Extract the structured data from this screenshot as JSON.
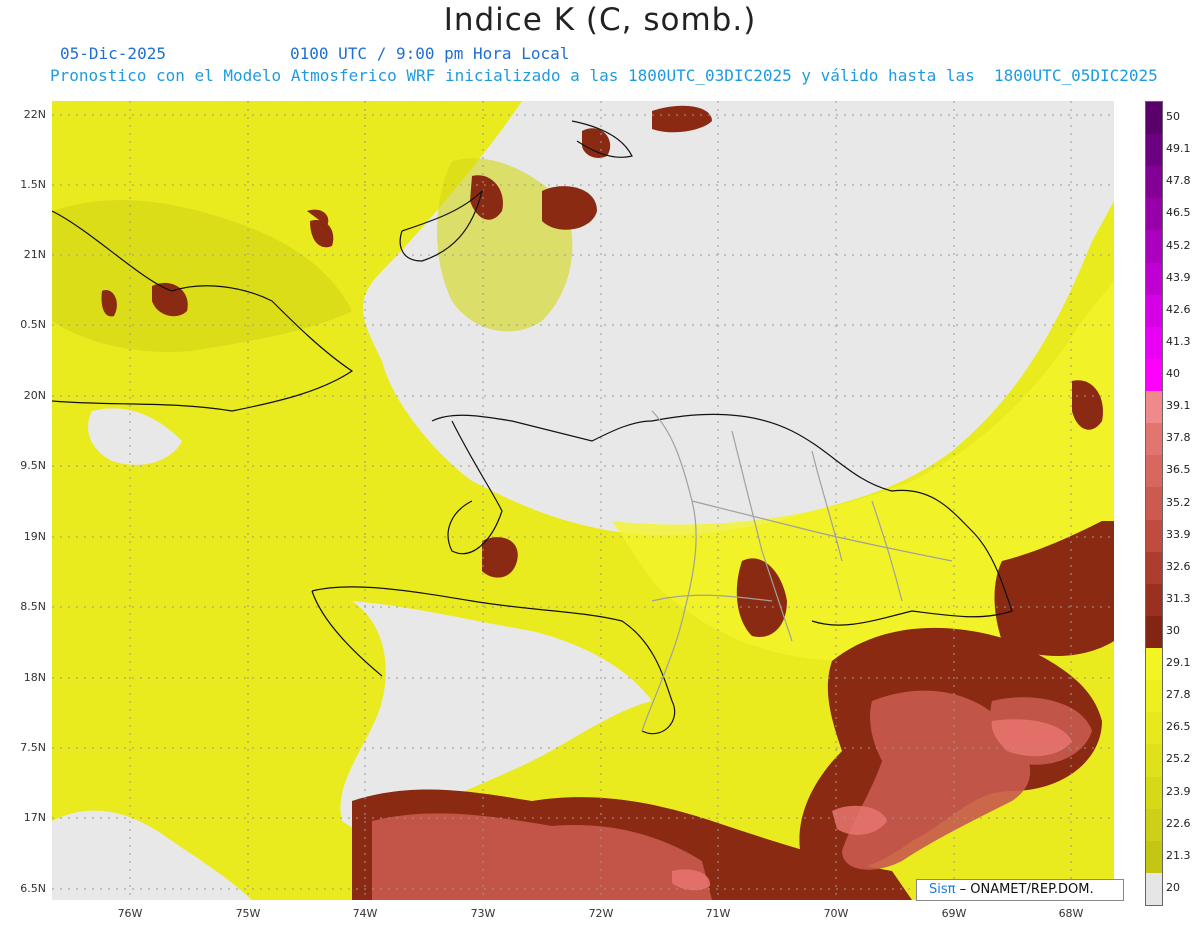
{
  "header": {
    "title": "Indice K (C, somb.)",
    "date": "05-Dic-2025",
    "time": "0100 UTC / 9:00 pm Hora Local",
    "model": "Pronostico con el Modelo Atmosferico WRF inicializado a las 1800UTC_03DIC2025 y válido hasta las  1800UTC_05DIC2025"
  },
  "map": {
    "lat_labels": [
      "22N",
      "1.5N",
      "21N",
      "0.5N",
      "20N",
      "9.5N",
      "19N",
      "8.5N",
      "18N",
      "7.5N",
      "17N",
      "6.5N"
    ],
    "lon_labels": [
      "76W",
      "75W",
      "74W",
      "73W",
      "72W",
      "71W",
      "70W",
      "69W",
      "68W"
    ],
    "fill_colors": {
      "no_data": "#e8e8e8",
      "low": "#d9dd1a",
      "mid": "#eff01c",
      "high": "#8a2a13",
      "higher": "#c85a4e",
      "peak": "#e8756e"
    }
  },
  "colorbar": {
    "labels": [
      "50",
      "49.1",
      "47.8",
      "46.5",
      "45.2",
      "43.9",
      "42.6",
      "41.3",
      "40",
      "39.1",
      "37.8",
      "36.5",
      "35.2",
      "33.9",
      "32.6",
      "31.3",
      "30",
      "29.1",
      "27.8",
      "26.5",
      "25.2",
      "23.9",
      "22.6",
      "21.3",
      "20"
    ],
    "colors": [
      "#5a006a",
      "#6d0080",
      "#820093",
      "#9700a8",
      "#ab00bd",
      "#c000d2",
      "#d500e6",
      "#ea00f5",
      "#ff00ff",
      "#f08a8a",
      "#e2756f",
      "#d8675f",
      "#cc5a4e",
      "#bf4c3f",
      "#ad3d2f",
      "#9a3020",
      "#842412",
      "#f3f522",
      "#eeef1f",
      "#e7e91c",
      "#dfe21a",
      "#d6d918",
      "#cdd016",
      "#c4c614",
      "#e6e6e6"
    ]
  },
  "credit": {
    "sis": "Sis",
    "pi": "π",
    "rest": "– ONAMET/REP.DOM."
  }
}
